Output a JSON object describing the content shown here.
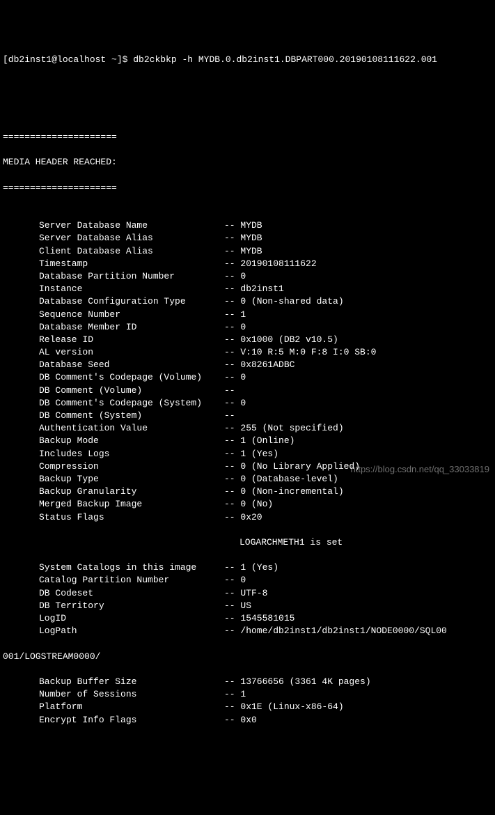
{
  "prompt": {
    "user_host": "[db2inst1@localhost ~]$ ",
    "command": "db2ckbkp -h MYDB.0.db2inst1.DBPART000.20190108111622.001"
  },
  "divider": "=====================",
  "header": "MEDIA HEADER REACHED:",
  "rows": [
    {
      "label": "Server Database Name",
      "value": "MYDB"
    },
    {
      "label": "Server Database Alias",
      "value": "MYDB"
    },
    {
      "label": "Client Database Alias",
      "value": "MYDB"
    },
    {
      "label": "Timestamp",
      "value": "20190108111622"
    },
    {
      "label": "Database Partition Number",
      "value": "0"
    },
    {
      "label": "Instance",
      "value": "db2inst1"
    },
    {
      "label": "Database Configuration Type",
      "value": "0 (Non-shared data)"
    },
    {
      "label": "Sequence Number",
      "value": "1"
    },
    {
      "label": "Database Member ID",
      "value": "0"
    },
    {
      "label": "Release ID",
      "value": "0x1000 (DB2 v10.5)"
    },
    {
      "label": "AL version",
      "value": "V:10 R:5 M:0 F:8 I:0 SB:0"
    },
    {
      "label": "Database Seed",
      "value": "0x8261ADBC"
    },
    {
      "label": "DB Comment's Codepage (Volume)",
      "value": "0"
    },
    {
      "label": "DB Comment (Volume)",
      "value": ""
    },
    {
      "label": "DB Comment's Codepage (System)",
      "value": "0"
    },
    {
      "label": "DB Comment (System)",
      "value": ""
    },
    {
      "label": "Authentication Value",
      "value": "255 (Not specified)"
    },
    {
      "label": "Backup Mode",
      "value": "1 (Online)"
    },
    {
      "label": "Includes Logs",
      "value": "1 (Yes)"
    },
    {
      "label": "Compression",
      "value": "0 (No Library Applied)"
    },
    {
      "label": "Backup Type",
      "value": "0 (Database-level)"
    },
    {
      "label": "Backup Granularity",
      "value": "0 (Non-incremental)"
    },
    {
      "label": "Merged Backup Image",
      "value": "0 (No)"
    },
    {
      "label": "Status Flags",
      "value": "0x20"
    }
  ],
  "status_flags_extra": "LOGARCHMETH1 is set",
  "rows2": [
    {
      "label": "System Catalogs in this image",
      "value": "1 (Yes)"
    },
    {
      "label": "Catalog Partition Number",
      "value": "0"
    },
    {
      "label": "DB Codeset",
      "value": "UTF-8"
    },
    {
      "label": "DB Territory",
      "value": "US"
    },
    {
      "label": "LogID",
      "value": "1545581015"
    },
    {
      "label": "LogPath",
      "value": "/home/db2inst1/db2inst1/NODE0000/SQL00"
    }
  ],
  "logpath_wrapped": "001/LOGSTREAM0000/",
  "rows3": [
    {
      "label": "Backup Buffer Size",
      "value": "13766656 (3361 4K pages)"
    },
    {
      "label": "Number of Sessions",
      "value": "1"
    },
    {
      "label": "Platform",
      "value": "0x1E (Linux-x86-64)"
    },
    {
      "label": "Encrypt Info Flags",
      "value": "0x0"
    }
  ],
  "watermark": "https://blog.csdn.net/qq_33033819"
}
